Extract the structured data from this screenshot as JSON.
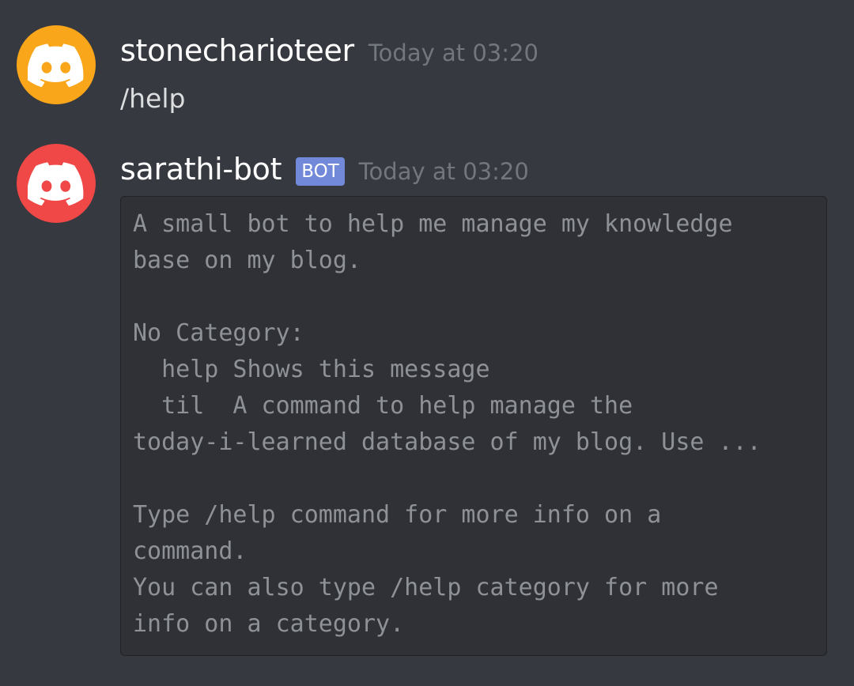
{
  "messages": [
    {
      "username": "stonecharioteer",
      "timestamp": "Today at 03:20",
      "avatar_color": "#faa61a",
      "avatar_icon": "discord-logo-icon",
      "text": "/help"
    },
    {
      "username": "sarathi-bot",
      "bot_tag": "BOT",
      "timestamp": "Today at 03:20",
      "avatar_color": "#f04747",
      "avatar_icon": "discord-logo-icon",
      "code_lines": [
        "A small bot to help me manage my knowledge",
        "base on my blog.",
        "",
        "No Category:",
        "  help Shows this message",
        "  til  A command to help manage the",
        "today-i-learned database of my blog. Use ...",
        "",
        "Type /help command for more info on a",
        "command.",
        "You can also type /help category for more",
        "info on a category."
      ]
    }
  ]
}
